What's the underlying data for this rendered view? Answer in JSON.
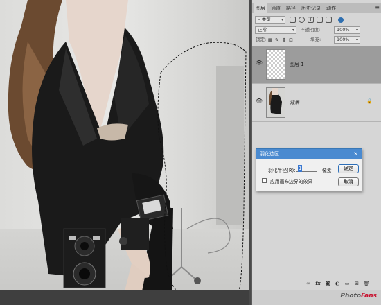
{
  "panel": {
    "tabs": [
      "图层",
      "通道",
      "路径",
      "历史记录",
      "动作"
    ],
    "filter_kind": "类型",
    "blend_mode": "正常",
    "opacity_label": "不透明度:",
    "opacity_value": "100%",
    "lock_label": "锁定:",
    "fill_label": "填充:",
    "fill_value": "100%",
    "layers": [
      {
        "name": "图层 1",
        "selected": true
      },
      {
        "name": "背景",
        "selected": false
      }
    ],
    "fx_label": "fx"
  },
  "dialog": {
    "title": "羽化选区",
    "close": "×",
    "radius_label": "羽化半径(R):",
    "radius_value": "1",
    "unit": "像素",
    "ok": "确定",
    "cancel": "取消",
    "checkbox_label": "应用画布边界的效果",
    "checkbox_checked": false
  },
  "watermark": {
    "part1": "Photo",
    "part2": "Fans"
  },
  "colors": {
    "dialog_title": "#4a8ad0",
    "selected_layer": "#9c9c9c",
    "brand_red": "#c8102e"
  },
  "icons": [
    "visibility-eye-icon",
    "lock-icon",
    "link-icon",
    "mask-icon",
    "adjustment-icon",
    "folder-icon",
    "new-layer-icon",
    "trash-icon"
  ]
}
